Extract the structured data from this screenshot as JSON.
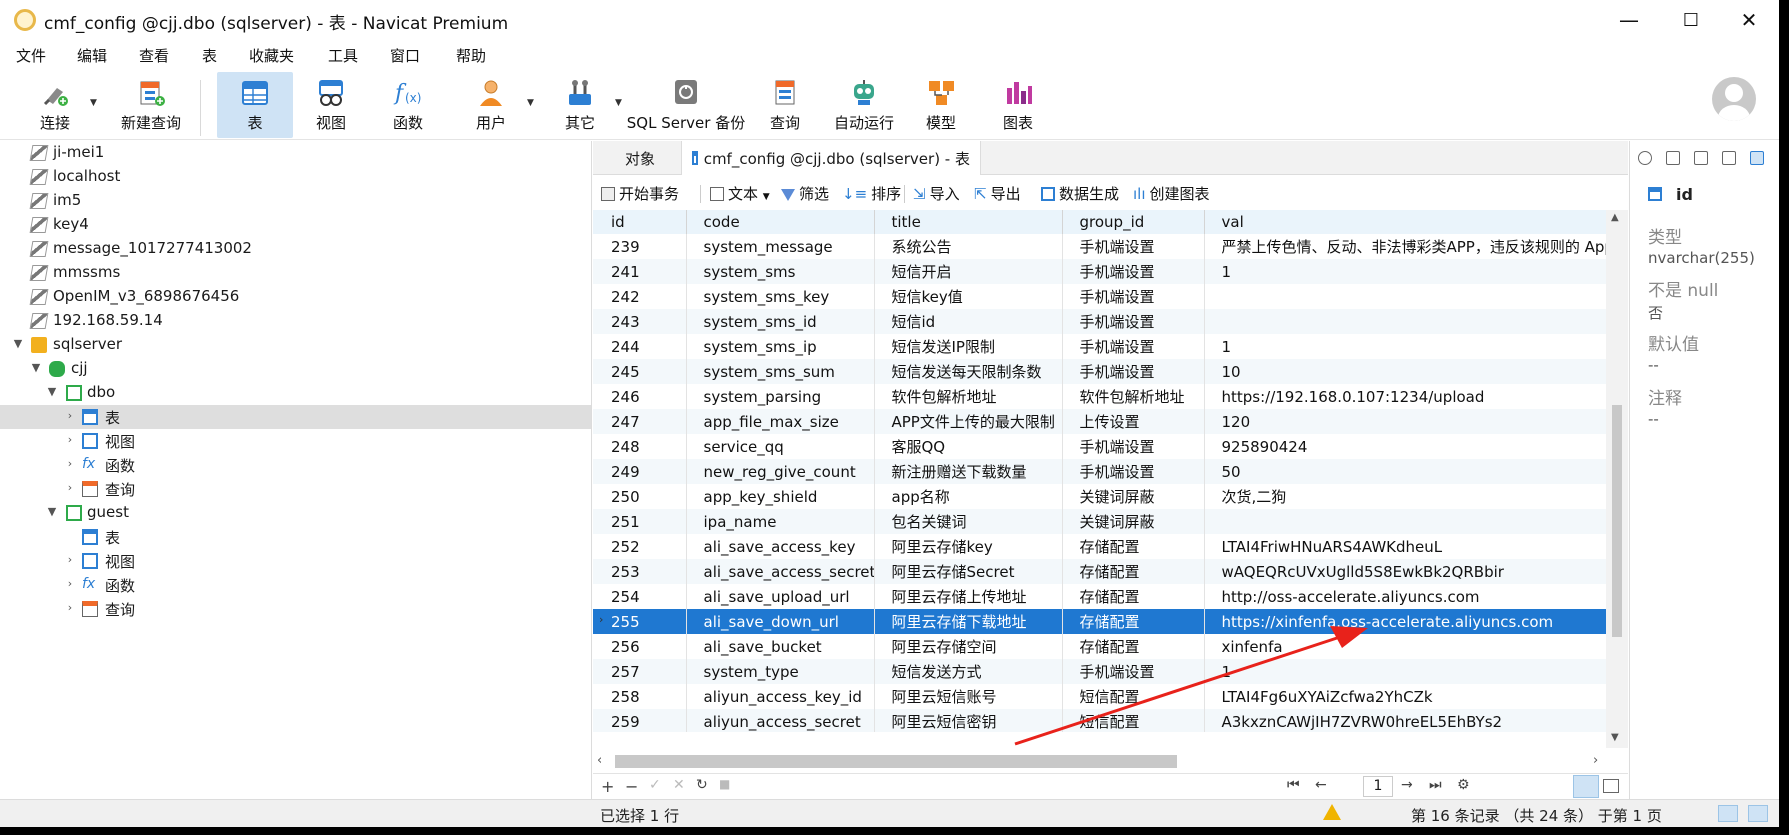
{
  "window": {
    "title": "cmf_config @cjj.dbo (sqlserver) - 表 - Navicat Premium",
    "minimize": "—",
    "maximize": "☐",
    "close": "✕"
  },
  "menu": [
    "文件",
    "编辑",
    "查看",
    "表",
    "收藏夹",
    "工具",
    "窗口",
    "帮助"
  ],
  "toolbar": {
    "connect": "连接",
    "new_query": "新建查询",
    "table": "表",
    "view": "视图",
    "function": "函数",
    "user": "用户",
    "other": "其它",
    "backup": "SQL Server 备份",
    "query": "查询",
    "automation": "自动运行",
    "model": "模型",
    "chart": "图表"
  },
  "tree": [
    {
      "label": "ji-mei1"
    },
    {
      "label": "localhost"
    },
    {
      "label": "im5"
    },
    {
      "label": "key4"
    },
    {
      "label": "message_1017277413002"
    },
    {
      "label": "mmssms"
    },
    {
      "label": "OpenIM_v3_6898676456"
    },
    {
      "label": "192.168.59.14"
    },
    {
      "label": "sqlserver"
    },
    {
      "label": "cjj"
    },
    {
      "label": "dbo"
    },
    {
      "label": "表"
    },
    {
      "label": "视图"
    },
    {
      "label": "函数"
    },
    {
      "label": "查询"
    },
    {
      "label": "guest"
    },
    {
      "label": "表"
    },
    {
      "label": "视图"
    },
    {
      "label": "函数"
    },
    {
      "label": "查询"
    }
  ],
  "tabs": {
    "objects": "对象",
    "active": "cmf_config @cjj.dbo (sqlserver) - 表"
  },
  "subtoolbar": {
    "begin_tx": "开始事务",
    "text": "文本",
    "filter": "筛选",
    "sort": "排序",
    "import": "导入",
    "export": "导出",
    "data_gen": "数据生成",
    "create_chart": "创建图表"
  },
  "grid": {
    "columns": [
      "id",
      "code",
      "title",
      "group_id",
      "val"
    ],
    "rows": [
      [
        "239",
        "system_message",
        "系统公告",
        "手机端设置",
        "严禁上传色情、反动、非法博彩类APP，违反该规则的 App"
      ],
      [
        "241",
        "system_sms",
        "短信开启",
        "手机端设置",
        "1"
      ],
      [
        "242",
        "system_sms_key",
        "短信key值",
        "手机端设置",
        ""
      ],
      [
        "243",
        "system_sms_id",
        "短信id",
        "手机端设置",
        ""
      ],
      [
        "244",
        "system_sms_ip",
        "短信发送IP限制",
        "手机端设置",
        "1"
      ],
      [
        "245",
        "system_sms_sum",
        "短信发送每天限制条数",
        "手机端设置",
        "10"
      ],
      [
        "246",
        "system_parsing",
        "软件包解析地址",
        "软件包解析地址",
        "https://192.168.0.107:1234/upload"
      ],
      [
        "247",
        "app_file_max_size",
        "APP文件上传的最大限制",
        "上传设置",
        "120"
      ],
      [
        "248",
        "service_qq",
        "客服QQ",
        "手机端设置",
        "925890424"
      ],
      [
        "249",
        "new_reg_give_count",
        "新注册赠送下载数量",
        "手机端设置",
        "50"
      ],
      [
        "250",
        "app_key_shield",
        "app名称",
        "关键词屏蔽",
        "次货,二狗"
      ],
      [
        "251",
        "ipa_name",
        "包名关键词",
        "关键词屏蔽",
        ""
      ],
      [
        "252",
        "ali_save_access_key",
        "阿里云存储key",
        "存储配置",
        "LTAI4FriwHNuARS4AWKdheuL"
      ],
      [
        "253",
        "ali_save_access_secret",
        "阿里云存储Secret",
        "存储配置",
        "wAQEQRcUVxUglld5S8EwkBk2QRBbir"
      ],
      [
        "254",
        "ali_save_upload_url",
        "阿里云存储上传地址",
        "存储配置",
        "http://oss-accelerate.aliyuncs.com"
      ],
      [
        "255",
        "ali_save_down_url",
        "阿里云存储下载地址",
        "存储配置",
        "https://xinfenfa.oss-accelerate.aliyuncs.com"
      ],
      [
        "256",
        "ali_save_bucket",
        "阿里云存储空间",
        "存储配置",
        "xinfenfa"
      ],
      [
        "257",
        "system_type",
        "短信发送方式",
        "手机端设置",
        "1"
      ],
      [
        "258",
        "aliyun_access_key_id",
        "阿里云短信账号",
        "短信配置",
        "LTAI4Fg6uXYAiZcfwa2YhCZk"
      ],
      [
        "259",
        "aliyun_access_secret",
        "阿里云短信密钥",
        "短信配置",
        "A3kxznCAWjIH7ZVRW0hreEL5EhBYs2"
      ]
    ],
    "selected_index": 15
  },
  "gridnav": {
    "add": "+",
    "remove": "−",
    "apply": "✓",
    "cancel": "✕",
    "refresh": "↻",
    "stop": "■",
    "first": "⏮",
    "prev": "←",
    "page": "1",
    "next": "→",
    "last": "⏭",
    "settings": "⚙"
  },
  "info": {
    "field_name": "id",
    "type_label": "类型",
    "type_value": "nvarchar(255)",
    "notnull_label": "不是 null",
    "notnull_value": "否",
    "default_label": "默认值",
    "default_value": "--",
    "comment_label": "注释",
    "comment_value": "--"
  },
  "status": {
    "selected": "已选择 1 行",
    "records": "第 16 条记录 （共 24 条） 于第 1 页"
  },
  "colors": {
    "selected_row": "#1f78d1",
    "header_bg": "#eaf4fb",
    "annotation_arrow": "#e8221b"
  }
}
